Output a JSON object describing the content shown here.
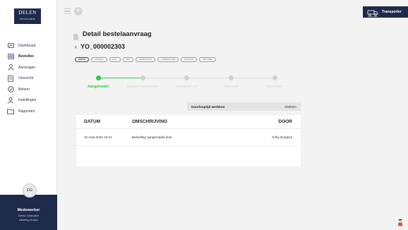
{
  "logo": {
    "name": "DELEN",
    "tagline": "PRIVATE BANK"
  },
  "sidebar": {
    "items": [
      {
        "label": "Dashboard",
        "icon": "dashboard-icon"
      },
      {
        "label": "Bestellen",
        "icon": "cart-icon",
        "active": true
      },
      {
        "label": "Aanvragen",
        "icon": "people-icon"
      },
      {
        "label": "Overzicht",
        "icon": "document-icon"
      },
      {
        "label": "Beheer",
        "icon": "manage-icon"
      },
      {
        "label": "Instellingen",
        "icon": "user-settings-icon"
      },
      {
        "label": "Rapporten",
        "icon": "folder-icon"
      }
    ]
  },
  "user": {
    "initials": "DG",
    "role": "Medewerker",
    "name": "Demo Gebruiker",
    "department": "Afdeling Kokke"
  },
  "topbar": {
    "transporter_label": "Transporter"
  },
  "page": {
    "title": "Detail bestelaanvraag",
    "order_number": "YO_000002303"
  },
  "chips": [
    "STATUS",
    "ARTIKELS",
    "INFO",
    "PDF",
    "LEVERANCIER",
    "COMMUNICATIE",
    "BIJLAGEN",
    "HISTORIEK"
  ],
  "steps": [
    {
      "label": "Aangemaakt",
      "active": true
    },
    {
      "label": "Budget toegewezen",
      "active": false
    },
    {
      "label": "Goedgekeurd",
      "active": false
    },
    {
      "label": "Geleverd",
      "active": false
    },
    {
      "label": "Afgesloten",
      "active": false
    }
  ],
  "duration": {
    "label": "Doorlooptijd werkbon",
    "value": "00d02m"
  },
  "table": {
    "headers": {
      "date": "DATUM",
      "description": "OMSCHRIJVING",
      "by": "DOOR"
    },
    "rows": [
      {
        "date": "10 maa 2023 13:12",
        "description": "Bestelling aangemaakt door",
        "by": "Kirby Borghys"
      }
    ]
  },
  "colors": {
    "navy": "#1e2a4a",
    "green": "#2ecc40",
    "background": "#f3f3f3"
  }
}
